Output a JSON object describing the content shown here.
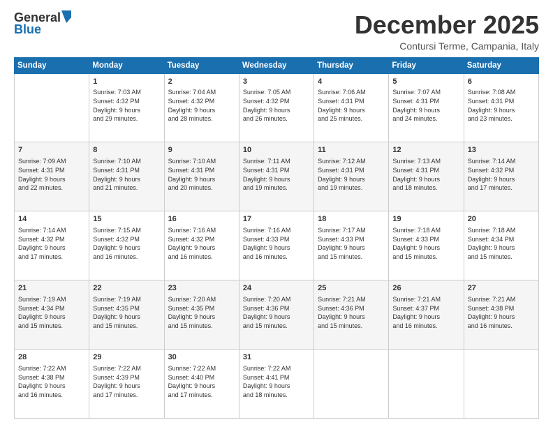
{
  "header": {
    "logo_general": "General",
    "logo_blue": "Blue",
    "month_title": "December 2025",
    "subtitle": "Contursi Terme, Campania, Italy"
  },
  "days_of_week": [
    "Sunday",
    "Monday",
    "Tuesday",
    "Wednesday",
    "Thursday",
    "Friday",
    "Saturday"
  ],
  "weeks": [
    [
      {
        "day": "",
        "info": ""
      },
      {
        "day": "1",
        "info": "Sunrise: 7:03 AM\nSunset: 4:32 PM\nDaylight: 9 hours\nand 29 minutes."
      },
      {
        "day": "2",
        "info": "Sunrise: 7:04 AM\nSunset: 4:32 PM\nDaylight: 9 hours\nand 28 minutes."
      },
      {
        "day": "3",
        "info": "Sunrise: 7:05 AM\nSunset: 4:32 PM\nDaylight: 9 hours\nand 26 minutes."
      },
      {
        "day": "4",
        "info": "Sunrise: 7:06 AM\nSunset: 4:31 PM\nDaylight: 9 hours\nand 25 minutes."
      },
      {
        "day": "5",
        "info": "Sunrise: 7:07 AM\nSunset: 4:31 PM\nDaylight: 9 hours\nand 24 minutes."
      },
      {
        "day": "6",
        "info": "Sunrise: 7:08 AM\nSunset: 4:31 PM\nDaylight: 9 hours\nand 23 minutes."
      }
    ],
    [
      {
        "day": "7",
        "info": "Sunrise: 7:09 AM\nSunset: 4:31 PM\nDaylight: 9 hours\nand 22 minutes."
      },
      {
        "day": "8",
        "info": "Sunrise: 7:10 AM\nSunset: 4:31 PM\nDaylight: 9 hours\nand 21 minutes."
      },
      {
        "day": "9",
        "info": "Sunrise: 7:10 AM\nSunset: 4:31 PM\nDaylight: 9 hours\nand 20 minutes."
      },
      {
        "day": "10",
        "info": "Sunrise: 7:11 AM\nSunset: 4:31 PM\nDaylight: 9 hours\nand 19 minutes."
      },
      {
        "day": "11",
        "info": "Sunrise: 7:12 AM\nSunset: 4:31 PM\nDaylight: 9 hours\nand 19 minutes."
      },
      {
        "day": "12",
        "info": "Sunrise: 7:13 AM\nSunset: 4:31 PM\nDaylight: 9 hours\nand 18 minutes."
      },
      {
        "day": "13",
        "info": "Sunrise: 7:14 AM\nSunset: 4:32 PM\nDaylight: 9 hours\nand 17 minutes."
      }
    ],
    [
      {
        "day": "14",
        "info": "Sunrise: 7:14 AM\nSunset: 4:32 PM\nDaylight: 9 hours\nand 17 minutes."
      },
      {
        "day": "15",
        "info": "Sunrise: 7:15 AM\nSunset: 4:32 PM\nDaylight: 9 hours\nand 16 minutes."
      },
      {
        "day": "16",
        "info": "Sunrise: 7:16 AM\nSunset: 4:32 PM\nDaylight: 9 hours\nand 16 minutes."
      },
      {
        "day": "17",
        "info": "Sunrise: 7:16 AM\nSunset: 4:33 PM\nDaylight: 9 hours\nand 16 minutes."
      },
      {
        "day": "18",
        "info": "Sunrise: 7:17 AM\nSunset: 4:33 PM\nDaylight: 9 hours\nand 15 minutes."
      },
      {
        "day": "19",
        "info": "Sunrise: 7:18 AM\nSunset: 4:33 PM\nDaylight: 9 hours\nand 15 minutes."
      },
      {
        "day": "20",
        "info": "Sunrise: 7:18 AM\nSunset: 4:34 PM\nDaylight: 9 hours\nand 15 minutes."
      }
    ],
    [
      {
        "day": "21",
        "info": "Sunrise: 7:19 AM\nSunset: 4:34 PM\nDaylight: 9 hours\nand 15 minutes."
      },
      {
        "day": "22",
        "info": "Sunrise: 7:19 AM\nSunset: 4:35 PM\nDaylight: 9 hours\nand 15 minutes."
      },
      {
        "day": "23",
        "info": "Sunrise: 7:20 AM\nSunset: 4:35 PM\nDaylight: 9 hours\nand 15 minutes."
      },
      {
        "day": "24",
        "info": "Sunrise: 7:20 AM\nSunset: 4:36 PM\nDaylight: 9 hours\nand 15 minutes."
      },
      {
        "day": "25",
        "info": "Sunrise: 7:21 AM\nSunset: 4:36 PM\nDaylight: 9 hours\nand 15 minutes."
      },
      {
        "day": "26",
        "info": "Sunrise: 7:21 AM\nSunset: 4:37 PM\nDaylight: 9 hours\nand 16 minutes."
      },
      {
        "day": "27",
        "info": "Sunrise: 7:21 AM\nSunset: 4:38 PM\nDaylight: 9 hours\nand 16 minutes."
      }
    ],
    [
      {
        "day": "28",
        "info": "Sunrise: 7:22 AM\nSunset: 4:38 PM\nDaylight: 9 hours\nand 16 minutes."
      },
      {
        "day": "29",
        "info": "Sunrise: 7:22 AM\nSunset: 4:39 PM\nDaylight: 9 hours\nand 17 minutes."
      },
      {
        "day": "30",
        "info": "Sunrise: 7:22 AM\nSunset: 4:40 PM\nDaylight: 9 hours\nand 17 minutes."
      },
      {
        "day": "31",
        "info": "Sunrise: 7:22 AM\nSunset: 4:41 PM\nDaylight: 9 hours\nand 18 minutes."
      },
      {
        "day": "",
        "info": ""
      },
      {
        "day": "",
        "info": ""
      },
      {
        "day": "",
        "info": ""
      }
    ]
  ]
}
